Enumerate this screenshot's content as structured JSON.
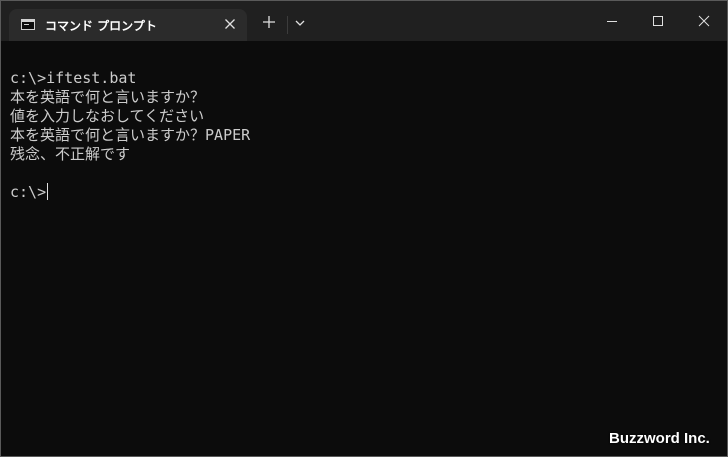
{
  "tab": {
    "title": "コマンド プロンプト",
    "icon": "console-icon",
    "close_icon": "close-icon"
  },
  "titlebar": {
    "new_tab_icon": "plus-icon",
    "dropdown_icon": "chevron-down-icon",
    "minimize_icon": "minimize-icon",
    "maximize_icon": "maximize-icon",
    "close_icon": "close-icon"
  },
  "terminal": {
    "lines": [
      "c:\\>iftest.bat",
      "本を英語で何と言いますか？",
      "値を入力しなおしてください",
      "本を英語で何と言いますか？PAPER",
      "残念、不正解です",
      "",
      "c:\\>"
    ]
  },
  "watermark": "Buzzword Inc.",
  "colors": {
    "titlebar_bg": "#202020",
    "tab_bg": "#2b2b2b",
    "terminal_bg": "#0c0c0c",
    "terminal_text": "#cccccc"
  }
}
